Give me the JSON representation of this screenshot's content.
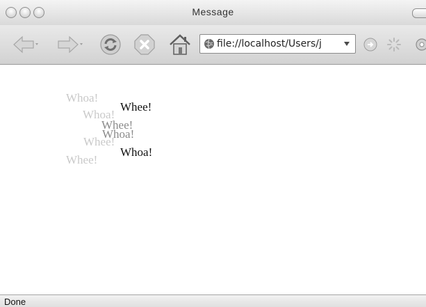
{
  "window": {
    "title": "Message"
  },
  "toolbar": {
    "url": "file://localhost/Users/j",
    "back_icon": "back-arrow",
    "forward_icon": "forward-arrow",
    "reload_icon": "reload",
    "stop_icon": "stop",
    "home_icon": "home"
  },
  "content": {
    "words": [
      "Whoa!",
      "Whee!",
      "Whoa!",
      "Whee!",
      "Whoa!",
      "Whee!",
      "Whoa!",
      "Whee!"
    ]
  },
  "status": {
    "text": "Done"
  },
  "colors": {
    "faint_text": "#c9c9c9",
    "dim_text": "#8a8a8a",
    "dark_text": "#111111"
  }
}
